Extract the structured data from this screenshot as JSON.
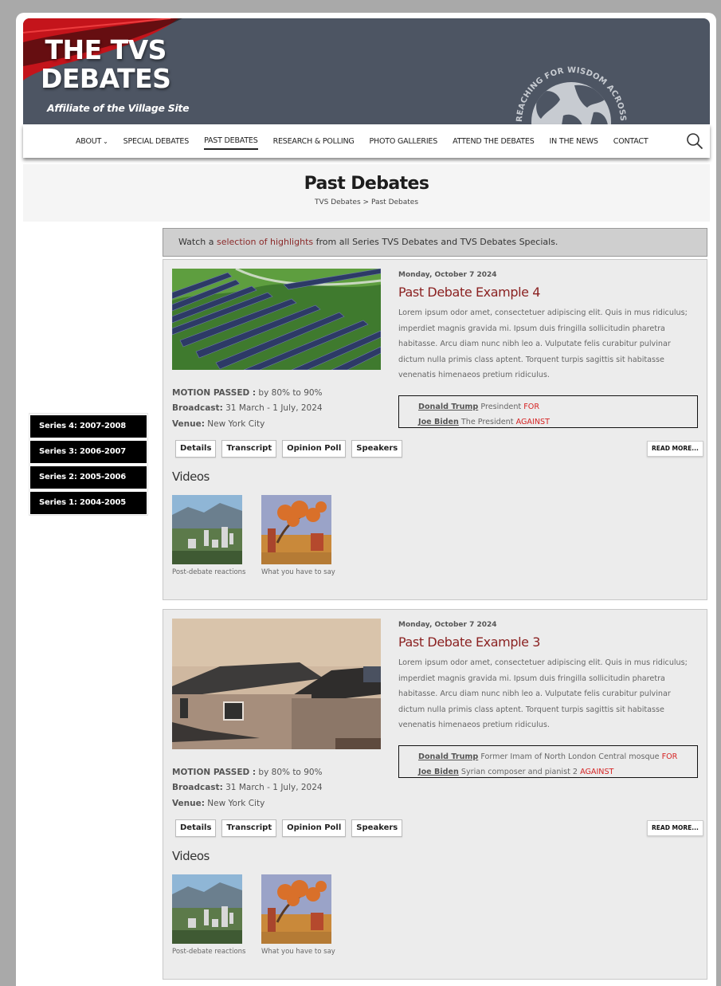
{
  "site": {
    "title_line1": "THE TVS",
    "title_line2": "DEBATES",
    "subtitle": "Affiliate of the Village Site",
    "globe_text": "REACHING FOR WISDOM ACROSS BOUNDARIES"
  },
  "nav": {
    "items": [
      {
        "label": "ABOUT"
      },
      {
        "label": "SPECIAL DEBATES"
      },
      {
        "label": "PAST DEBATES"
      },
      {
        "label": "RESEARCH & POLLING"
      },
      {
        "label": "PHOTO GALLERIES"
      },
      {
        "label": "ATTEND THE DEBATES"
      },
      {
        "label": "IN THE NEWS"
      },
      {
        "label": "CONTACT"
      }
    ],
    "about_chevron": "⌄"
  },
  "page": {
    "title": "Past Debates",
    "breadcrumb_home": "TVS Debates",
    "breadcrumb_sep": ">",
    "breadcrumb_current": "Past Debates"
  },
  "sidebar": {
    "series": [
      {
        "label": "Series 4: 2007-2008"
      },
      {
        "label": "Series 3: 2006-2007"
      },
      {
        "label": "Series 2: 2005-2006"
      },
      {
        "label": "Series 1: 2004-2005"
      }
    ]
  },
  "notice": {
    "prefix": "Watch a",
    "link": "selection of highlights",
    "suffix": "from all Series  TVS Debates and TVS  Debates Specials."
  },
  "labels": {
    "motion": "MOTION PASSED :",
    "broadcast": "Broadcast:",
    "venue": "Venue:",
    "details": "Details",
    "transcript": "Transcript",
    "poll": "Opinion Poll",
    "speakers": "Speakers",
    "read_more": "READ MORE...",
    "videos": "Videos"
  },
  "debates": [
    {
      "date": "Monday, October 7 2024",
      "title": "Past Debate Example 4",
      "description": "Lorem ipsum odor amet, consectetuer adipiscing elit. Quis in mus ridiculus; imperdiet magnis gravida mi. Ipsum duis fringilla sollicitudin pharetra habitasse. Arcu diam nunc nibh leo a. Vulputate felis curabitur pulvinar dictum nulla primis class aptent. Torquent turpis sagittis sit habitasse venenatis himenaeos pretium ridiculus.",
      "motion_value": "by 80% to 90%",
      "broadcast_value": "31 March - 1 July, 2024",
      "venue_value": "New York City",
      "speakers": [
        {
          "name": "Donald Trump",
          "role": "Presindent",
          "side": "FOR"
        },
        {
          "name": "Joe Biden",
          "role": "The President",
          "side": "AGAINST"
        }
      ],
      "videos": [
        {
          "caption": "Post-debate reactions"
        },
        {
          "caption": "What you have to say"
        }
      ]
    },
    {
      "date": "Monday, October 7 2024",
      "title": "Past Debate Example 3",
      "description": "Lorem ipsum odor amet, consectetuer adipiscing elit. Quis in mus ridiculus; imperdiet magnis gravida mi. Ipsum duis fringilla sollicitudin pharetra habitasse. Arcu diam nunc nibh leo a. Vulputate felis curabitur pulvinar dictum nulla primis class aptent. Torquent turpis sagittis sit habitasse venenatis himenaeos pretium ridiculus.",
      "motion_value": "by 80% to 90%",
      "broadcast_value": "31 March - 1 July, 2024",
      "venue_value": "New York City",
      "speakers": [
        {
          "name": "Donald Trump",
          "role": "Former Imam of North London Central mosque",
          "side": "FOR"
        },
        {
          "name": "Joe Biden",
          "role": "Syrian composer and pianist 2",
          "side": "AGAINST"
        }
      ],
      "videos": [
        {
          "caption": "Post-debate reactions"
        },
        {
          "caption": "What you have to say"
        }
      ]
    }
  ],
  "colors": {
    "header_bg": "#4d5563",
    "accent_red": "#8b2222",
    "for_against": "#d62424"
  }
}
